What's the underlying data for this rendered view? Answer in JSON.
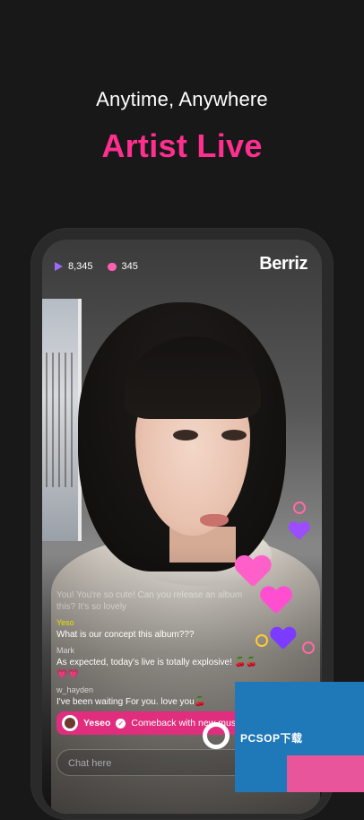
{
  "header": {
    "subtitle": "Anytime, Anywhere",
    "title": "Artist Live"
  },
  "live": {
    "views": "8,345",
    "hearts": "345",
    "logo": "Berriz"
  },
  "chat": {
    "messages": [
      {
        "user": "",
        "text": "You! You're so cute! Can you release an album this? It's so lovely",
        "faded": true
      },
      {
        "user": "Yeso",
        "text": "What is our concept this album???"
      },
      {
        "user": "Mark",
        "text": "As expected, today's live is totally explosive! 🍒🍒💗💗"
      },
      {
        "user": "w_hayden",
        "text": "I've been waiting For you. love you🍒"
      }
    ],
    "pinned": {
      "user": "Yeseo",
      "text": "Comeback with new music"
    },
    "input_placeholder": "Chat here"
  },
  "colors": {
    "accent": "#ff2f8f",
    "pinned_bg": "#e02d7d",
    "background": "#181818"
  },
  "icons": {
    "views": "play-icon",
    "hearts": "gem-heart-icon",
    "verified": "check-icon"
  },
  "watermark": {
    "text": "PCSOP下载"
  }
}
